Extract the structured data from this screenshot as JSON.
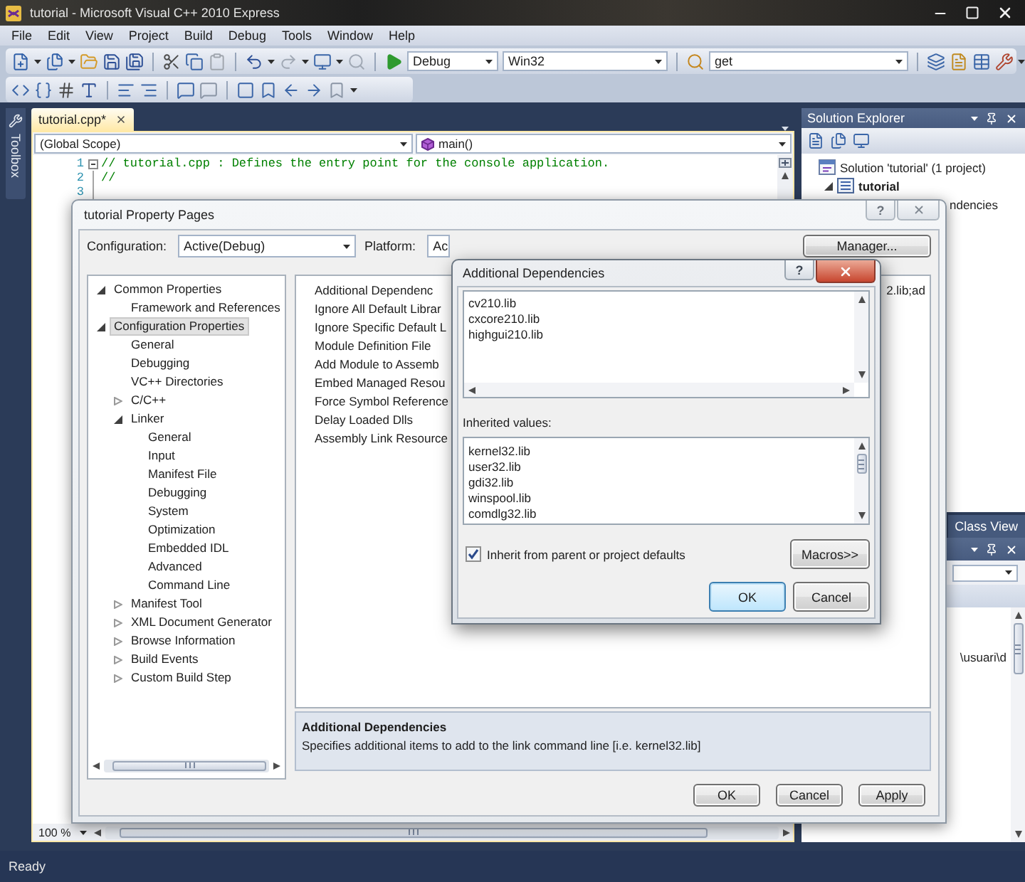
{
  "window": {
    "title": "tutorial - Microsoft Visual C++ 2010 Express"
  },
  "menu": [
    "File",
    "Edit",
    "View",
    "Project",
    "Build",
    "Debug",
    "Tools",
    "Window",
    "Help"
  ],
  "toolbar": {
    "configuration": "Debug",
    "platform": "Win32",
    "find": "get"
  },
  "toolbox_tab": "Toolbox",
  "document_tab": {
    "label": "tutorial.cpp*",
    "selected": true
  },
  "editor": {
    "scope": "(Global Scope)",
    "member": "main()",
    "lines": [
      {
        "number": "1",
        "kind": "comment",
        "code": "// tutorial.cpp : Defines the entry point for the console application."
      },
      {
        "number": "2",
        "kind": "comment",
        "code": "//"
      },
      {
        "number": "3"
      }
    ],
    "zoom": "100 %"
  },
  "solution_explorer": {
    "title": "Solution Explorer",
    "items": [
      {
        "label": "Solution 'tutorial' (1 project)",
        "children": [
          {
            "label": "tutorial",
            "expanded": true,
            "children": [
              {
                "label": "ndencies"
              }
            ]
          }
        ]
      }
    ]
  },
  "panel_tabs": [
    {
      "label": "Class View",
      "selected": false
    }
  ],
  "class_view": {
    "path": "\\usuari\\d"
  },
  "property_pages": {
    "title": "tutorial Property Pages",
    "help_button": "?",
    "configuration_label": "Configuration:",
    "configuration": "Active(Debug)",
    "platform_label": "Platform:",
    "platform": "Ac",
    "manager_button": "Manager...",
    "tree": [
      {
        "label": "Common Properties",
        "expanded": true,
        "selected": false,
        "children": [
          {
            "label": "Framework and References",
            "selected": false
          }
        ]
      },
      {
        "label": "Configuration Properties",
        "expanded": true,
        "selected": true,
        "children": [
          {
            "label": "General",
            "selected": false
          },
          {
            "label": "Debugging",
            "selected": false
          },
          {
            "label": "VC++ Directories",
            "selected": false
          },
          {
            "label": "C/C++",
            "expanded": false,
            "selected": false
          },
          {
            "label": "Linker",
            "expanded": true,
            "selected": false,
            "children": [
              {
                "label": "General",
                "selected": false
              },
              {
                "label": "Input",
                "selected": false
              },
              {
                "label": "Manifest File",
                "selected": false
              },
              {
                "label": "Debugging",
                "selected": false
              },
              {
                "label": "System",
                "selected": false
              },
              {
                "label": "Optimization",
                "selected": false
              },
              {
                "label": "Embedded IDL",
                "selected": false
              },
              {
                "label": "Advanced",
                "selected": false
              },
              {
                "label": "Command Line",
                "selected": false
              }
            ]
          },
          {
            "label": "Manifest Tool",
            "expanded": false,
            "selected": false
          },
          {
            "label": "XML Document Generator",
            "expanded": false,
            "selected": false
          },
          {
            "label": "Browse Information",
            "expanded": false,
            "selected": false
          },
          {
            "label": "Build Events",
            "expanded": false,
            "selected": false
          },
          {
            "label": "Custom Build Step",
            "expanded": false,
            "selected": false
          }
        ]
      }
    ],
    "properties": [
      {
        "name": "Additional Dependenc",
        "value": "2.lib;ad"
      },
      {
        "name": "Ignore All Default Librar"
      },
      {
        "name": "Ignore Specific Default L"
      },
      {
        "name": "Module Definition File"
      },
      {
        "name": "Add Module to Assemb"
      },
      {
        "name": "Embed Managed Resou"
      },
      {
        "name": "Force Symbol Reference"
      },
      {
        "name": "Delay Loaded Dlls"
      },
      {
        "name": "Assembly Link Resource"
      }
    ],
    "description": {
      "title": "Additional Dependencies",
      "text": "Specifies additional items to add to the link command line [i.e. kernel32.lib]"
    },
    "buttons": [
      "OK",
      "Cancel",
      "Apply"
    ]
  },
  "additional_dependencies": {
    "title": "Additional Dependencies",
    "help_button": "?",
    "entries": [
      "cv210.lib",
      "cxcore210.lib",
      "highgui210.lib"
    ],
    "inherited_label": "Inherited values:",
    "inherited": [
      "kernel32.lib",
      "user32.lib",
      "gdi32.lib",
      "winspool.lib",
      "comdlg32.lib"
    ],
    "inherit": {
      "label": "Inherit from parent or project defaults",
      "checked": true
    },
    "macros_button": "Macros>>",
    "buttons": [
      {
        "label": "OK",
        "default": true
      },
      {
        "label": "Cancel",
        "default": false
      }
    ]
  },
  "status_bar": "Ready"
}
